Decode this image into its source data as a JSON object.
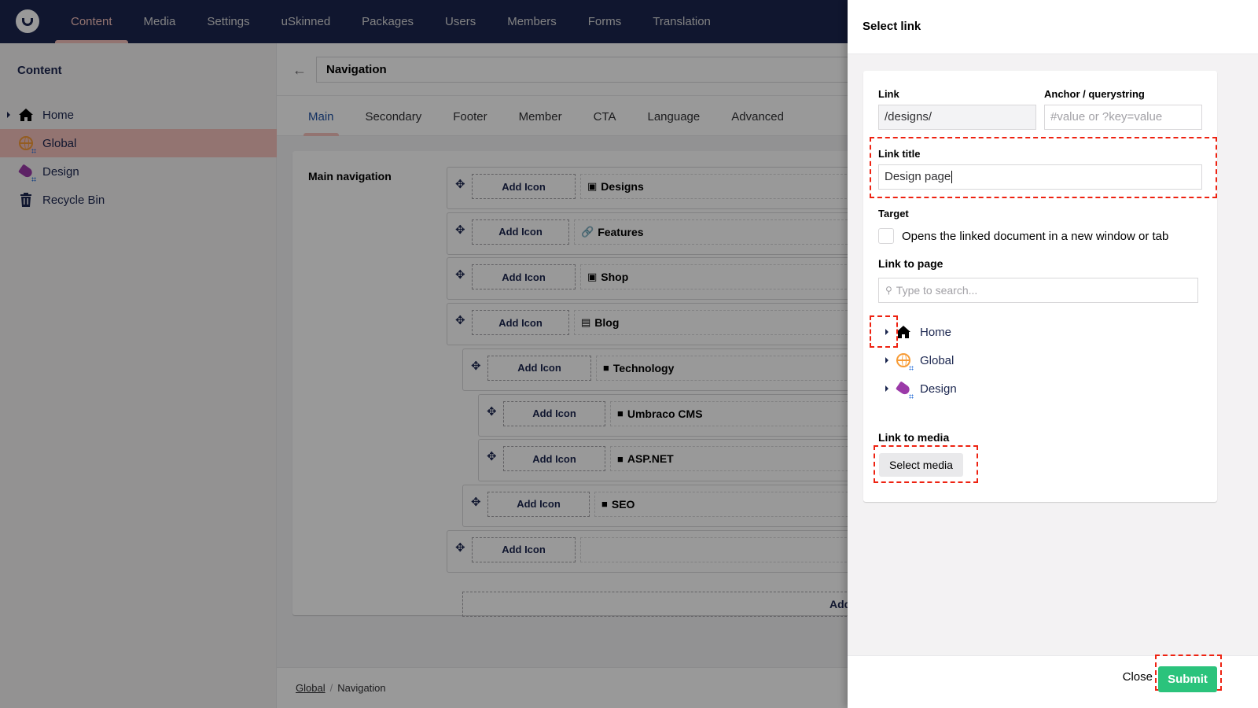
{
  "topbar": {
    "logo": "umbraco-logo",
    "nav": [
      {
        "label": "Content",
        "active": true
      },
      {
        "label": "Media"
      },
      {
        "label": "Settings"
      },
      {
        "label": "uSkinned"
      },
      {
        "label": "Packages"
      },
      {
        "label": "Users"
      },
      {
        "label": "Members"
      },
      {
        "label": "Forms"
      },
      {
        "label": "Translation"
      }
    ]
  },
  "sidebar": {
    "title": "Content",
    "items": [
      {
        "label": "Home",
        "icon": "home-icon",
        "has_children": true
      },
      {
        "label": "Global",
        "icon": "globe-icon",
        "selected": true
      },
      {
        "label": "Design",
        "icon": "tag-icon"
      },
      {
        "label": "Recycle Bin",
        "icon": "trash-icon"
      }
    ]
  },
  "editor": {
    "name": "Navigation",
    "tabs": [
      {
        "label": "Main",
        "active": true
      },
      {
        "label": "Secondary"
      },
      {
        "label": "Footer"
      },
      {
        "label": "Member"
      },
      {
        "label": "CTA"
      },
      {
        "label": "Language"
      },
      {
        "label": "Advanced"
      }
    ],
    "property_label": "Main navigation",
    "add_icon_label": "Add Icon",
    "add_label": "Add",
    "nav_items": [
      {
        "title": "Designs",
        "icon": "page-icon",
        "level": 0
      },
      {
        "title": "Features",
        "icon": "link-icon",
        "level": 0
      },
      {
        "title": "Shop",
        "icon": "page-icon",
        "level": 0
      },
      {
        "title": "Blog",
        "icon": "newspaper-icon",
        "level": 0
      },
      {
        "title": "Technology",
        "icon": "folder-icon",
        "level": 1
      },
      {
        "title": "Umbraco CMS",
        "icon": "folder-icon",
        "level": 2
      },
      {
        "title": "ASP.NET",
        "icon": "folder-icon",
        "level": 2
      },
      {
        "title": "SEO",
        "icon": "folder-icon",
        "level": 1
      },
      {
        "title": "",
        "icon": "",
        "level": 0
      }
    ],
    "breadcrumb": [
      {
        "label": "Global",
        "link": true
      },
      {
        "label": "Navigation",
        "link": false
      }
    ]
  },
  "dialog": {
    "title": "Select link",
    "link_label": "Link",
    "link_value": "/designs/",
    "anchor_label": "Anchor / querystring",
    "anchor_placeholder": "#value or ?key=value",
    "title_label": "Link title",
    "title_value": "Design page",
    "target_label": "Target",
    "target_checkbox_label": "Opens the linked document in a new window or tab",
    "target_checked": false,
    "link_to_page_label": "Link to page",
    "search_placeholder": "Type to search...",
    "tree": [
      {
        "label": "Home",
        "icon": "home-icon"
      },
      {
        "label": "Global",
        "icon": "globe-icon"
      },
      {
        "label": "Design",
        "icon": "tag-icon"
      }
    ],
    "link_to_media_label": "Link to media",
    "select_media_label": "Select media",
    "close_label": "Close",
    "submit_label": "Submit"
  },
  "colors": {
    "topbar": "#1b264f",
    "accent_pink": "#f5c1bc",
    "submit_green": "#2bc37c",
    "highlight_red": "#ee2211",
    "active_tab": "#2152a3"
  }
}
